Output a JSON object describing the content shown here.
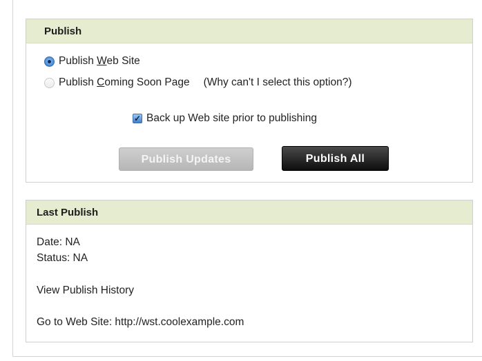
{
  "publish": {
    "title": "Publish",
    "option_web_site": {
      "pre": "Publish ",
      "hotkey": "W",
      "post": "eb Site",
      "selected": true
    },
    "option_coming_soon": {
      "pre": "Publish ",
      "hotkey": "C",
      "post": "oming Soon Page",
      "selected": false,
      "disabled": true
    },
    "help_text": "(Why can't I select this option?)",
    "backup_label": "Back up Web site prior to publishing",
    "backup_checked": true,
    "publish_updates_label": "Publish Updates",
    "publish_all_label": "Publish All"
  },
  "last_publish": {
    "title": "Last Publish",
    "date_line": "Date: NA",
    "status_line": "Status: NA",
    "history_link": "View Publish History",
    "website_line": "Go to Web Site: http://wst.coolexample.com"
  },
  "colors": {
    "header_bg": "#e6ecd0",
    "panel_border": "#cfcfcf",
    "button_dark": "#111111",
    "button_disabled": "#c4c4c4",
    "accent_blue": "#4f8fd6"
  }
}
